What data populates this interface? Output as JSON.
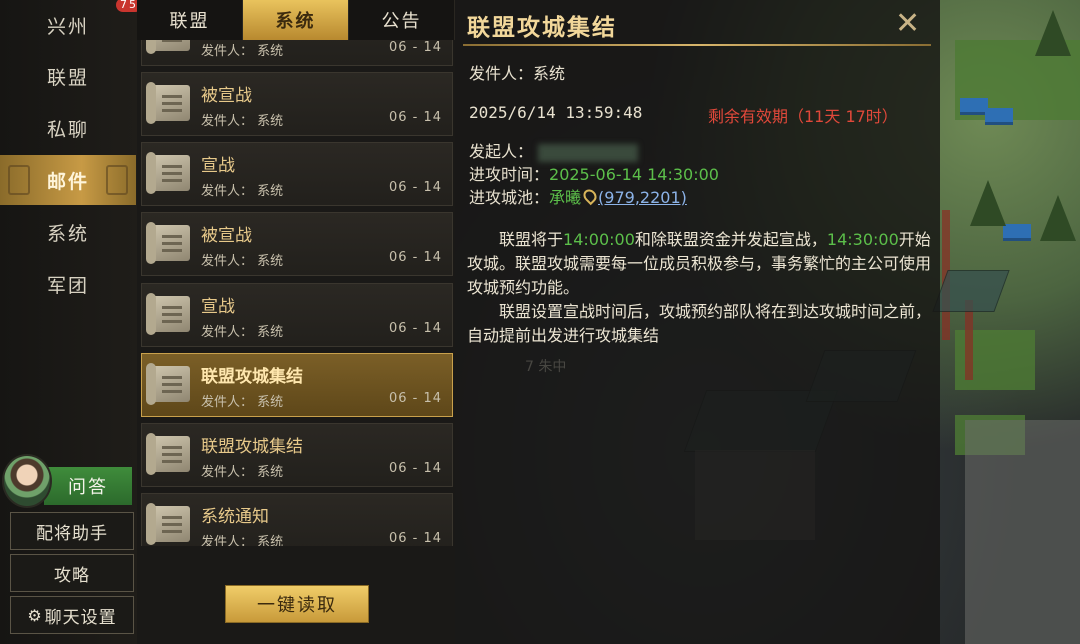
{
  "nav": {
    "badge": "75",
    "items": [
      {
        "label": "兴州"
      },
      {
        "label": "联盟"
      },
      {
        "label": "私聊"
      },
      {
        "label": "邮件"
      },
      {
        "label": "系统"
      },
      {
        "label": "军团"
      }
    ],
    "qa_label": "问答",
    "assistant_label": "配将助手",
    "guide_label": "攻略",
    "chat_settings_label": "聊天设置"
  },
  "tabs": [
    {
      "label": "联盟"
    },
    {
      "label": "系统"
    },
    {
      "label": "公告"
    }
  ],
  "mails": [
    {
      "title": "",
      "sender": "发件人： 系统",
      "date": "06 - 14"
    },
    {
      "title": "被宣战",
      "sender": "发件人： 系统",
      "date": "06 - 14"
    },
    {
      "title": "宣战",
      "sender": "发件人： 系统",
      "date": "06 - 14"
    },
    {
      "title": "被宣战",
      "sender": "发件人： 系统",
      "date": "06 - 14"
    },
    {
      "title": "宣战",
      "sender": "发件人： 系统",
      "date": "06 - 14"
    },
    {
      "title": "联盟攻城集结",
      "sender": "发件人： 系统",
      "date": "06 - 14"
    },
    {
      "title": "联盟攻城集结",
      "sender": "发件人： 系统",
      "date": "06 - 14"
    },
    {
      "title": "系统通知",
      "sender": "发件人： 系统",
      "date": "06 - 14"
    }
  ],
  "read_all_label": "一键读取",
  "detail": {
    "title": "联盟攻城集结",
    "sender": "发件人：系统",
    "datetime": "2025/6/14 13:59:48",
    "validity": "剩余有效期（11天 17时）",
    "initiator_label": "发起人：",
    "attack_time_label": "进攻时间：",
    "attack_time": "2025-06-14 14:30:00",
    "target_label": "进攻城池：",
    "target_name": "承曦",
    "target_coords": "(979,2201)",
    "p1_a": "联盟将于",
    "p1_time1": "14:00:00",
    "p1_b": "和除联盟资金并发起宣战，",
    "p1_time2": "14:30:00",
    "p1_c": "开始攻城。联盟攻城需要每一位成员积极参与，事务繁忙的主公可使用攻城预约功能。",
    "p2": "联盟设置宣战时间后，攻城预约部队将在到达攻城时间之前，自动提前出发进行攻城集结",
    "faded_text": "7  朱中"
  }
}
